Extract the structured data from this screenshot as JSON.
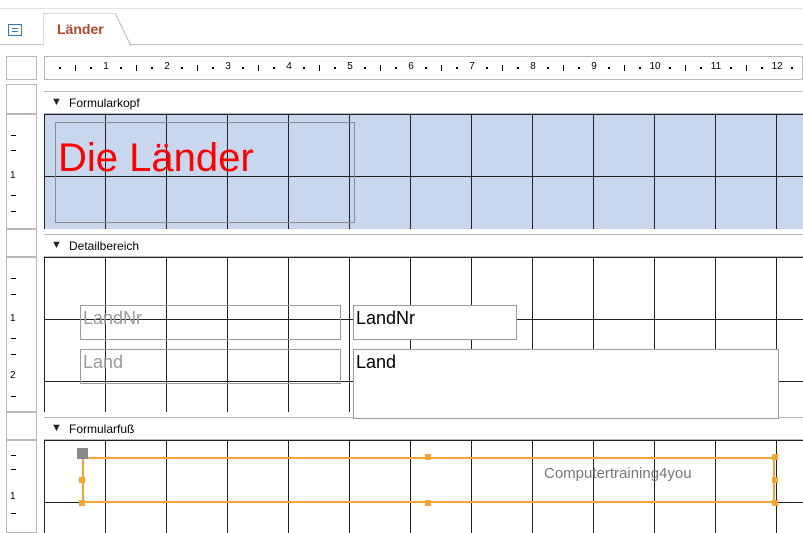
{
  "tab": {
    "label": "Länder",
    "icon": "form-icon"
  },
  "ruler": {
    "numbers": [
      "1",
      "2",
      "3",
      "4",
      "5",
      "6",
      "7",
      "8",
      "9",
      "10",
      "11",
      "12"
    ]
  },
  "vruler": {
    "header_num": "1",
    "detail_num1": "1",
    "detail_num2": "2",
    "footer_num": "1"
  },
  "sections": {
    "header": {
      "label": "Formularkopf"
    },
    "detail": {
      "label": "Detailbereich"
    },
    "footer": {
      "label": "Formularfuß"
    }
  },
  "controls": {
    "title": "Die Länder",
    "label_landnr": "LandNr",
    "label_land": "Land",
    "text_landnr": "LandNr",
    "text_land": "Land",
    "footer_text": "Computertraining4you"
  },
  "colors": {
    "header_bg": "#c8d7ee",
    "title": "#ff0000",
    "selection": "#f5a534",
    "tab_text": "#b7472a"
  }
}
